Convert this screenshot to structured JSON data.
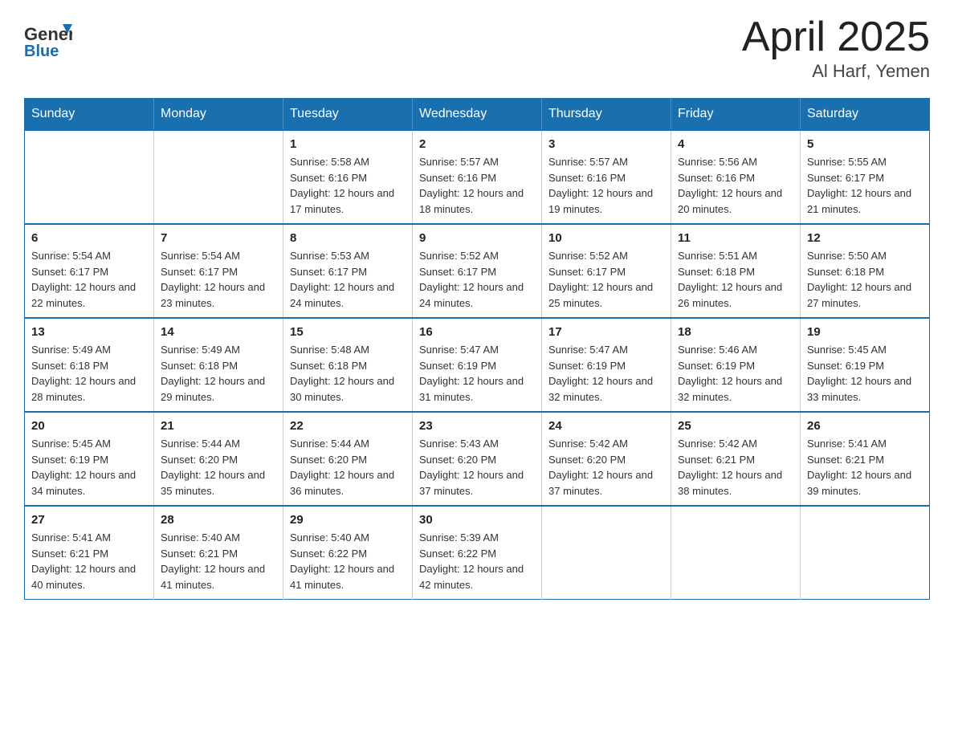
{
  "header": {
    "logo_general": "General",
    "logo_blue": "Blue",
    "title": "April 2025",
    "subtitle": "Al Harf, Yemen"
  },
  "days_of_week": [
    "Sunday",
    "Monday",
    "Tuesday",
    "Wednesday",
    "Thursday",
    "Friday",
    "Saturday"
  ],
  "weeks": [
    {
      "days": [
        {
          "number": "",
          "sunrise": "",
          "sunset": "",
          "daylight": ""
        },
        {
          "number": "",
          "sunrise": "",
          "sunset": "",
          "daylight": ""
        },
        {
          "number": "1",
          "sunrise": "Sunrise: 5:58 AM",
          "sunset": "Sunset: 6:16 PM",
          "daylight": "Daylight: 12 hours and 17 minutes."
        },
        {
          "number": "2",
          "sunrise": "Sunrise: 5:57 AM",
          "sunset": "Sunset: 6:16 PM",
          "daylight": "Daylight: 12 hours and 18 minutes."
        },
        {
          "number": "3",
          "sunrise": "Sunrise: 5:57 AM",
          "sunset": "Sunset: 6:16 PM",
          "daylight": "Daylight: 12 hours and 19 minutes."
        },
        {
          "number": "4",
          "sunrise": "Sunrise: 5:56 AM",
          "sunset": "Sunset: 6:16 PM",
          "daylight": "Daylight: 12 hours and 20 minutes."
        },
        {
          "number": "5",
          "sunrise": "Sunrise: 5:55 AM",
          "sunset": "Sunset: 6:17 PM",
          "daylight": "Daylight: 12 hours and 21 minutes."
        }
      ]
    },
    {
      "days": [
        {
          "number": "6",
          "sunrise": "Sunrise: 5:54 AM",
          "sunset": "Sunset: 6:17 PM",
          "daylight": "Daylight: 12 hours and 22 minutes."
        },
        {
          "number": "7",
          "sunrise": "Sunrise: 5:54 AM",
          "sunset": "Sunset: 6:17 PM",
          "daylight": "Daylight: 12 hours and 23 minutes."
        },
        {
          "number": "8",
          "sunrise": "Sunrise: 5:53 AM",
          "sunset": "Sunset: 6:17 PM",
          "daylight": "Daylight: 12 hours and 24 minutes."
        },
        {
          "number": "9",
          "sunrise": "Sunrise: 5:52 AM",
          "sunset": "Sunset: 6:17 PM",
          "daylight": "Daylight: 12 hours and 24 minutes."
        },
        {
          "number": "10",
          "sunrise": "Sunrise: 5:52 AM",
          "sunset": "Sunset: 6:17 PM",
          "daylight": "Daylight: 12 hours and 25 minutes."
        },
        {
          "number": "11",
          "sunrise": "Sunrise: 5:51 AM",
          "sunset": "Sunset: 6:18 PM",
          "daylight": "Daylight: 12 hours and 26 minutes."
        },
        {
          "number": "12",
          "sunrise": "Sunrise: 5:50 AM",
          "sunset": "Sunset: 6:18 PM",
          "daylight": "Daylight: 12 hours and 27 minutes."
        }
      ]
    },
    {
      "days": [
        {
          "number": "13",
          "sunrise": "Sunrise: 5:49 AM",
          "sunset": "Sunset: 6:18 PM",
          "daylight": "Daylight: 12 hours and 28 minutes."
        },
        {
          "number": "14",
          "sunrise": "Sunrise: 5:49 AM",
          "sunset": "Sunset: 6:18 PM",
          "daylight": "Daylight: 12 hours and 29 minutes."
        },
        {
          "number": "15",
          "sunrise": "Sunrise: 5:48 AM",
          "sunset": "Sunset: 6:18 PM",
          "daylight": "Daylight: 12 hours and 30 minutes."
        },
        {
          "number": "16",
          "sunrise": "Sunrise: 5:47 AM",
          "sunset": "Sunset: 6:19 PM",
          "daylight": "Daylight: 12 hours and 31 minutes."
        },
        {
          "number": "17",
          "sunrise": "Sunrise: 5:47 AM",
          "sunset": "Sunset: 6:19 PM",
          "daylight": "Daylight: 12 hours and 32 minutes."
        },
        {
          "number": "18",
          "sunrise": "Sunrise: 5:46 AM",
          "sunset": "Sunset: 6:19 PM",
          "daylight": "Daylight: 12 hours and 32 minutes."
        },
        {
          "number": "19",
          "sunrise": "Sunrise: 5:45 AM",
          "sunset": "Sunset: 6:19 PM",
          "daylight": "Daylight: 12 hours and 33 minutes."
        }
      ]
    },
    {
      "days": [
        {
          "number": "20",
          "sunrise": "Sunrise: 5:45 AM",
          "sunset": "Sunset: 6:19 PM",
          "daylight": "Daylight: 12 hours and 34 minutes."
        },
        {
          "number": "21",
          "sunrise": "Sunrise: 5:44 AM",
          "sunset": "Sunset: 6:20 PM",
          "daylight": "Daylight: 12 hours and 35 minutes."
        },
        {
          "number": "22",
          "sunrise": "Sunrise: 5:44 AM",
          "sunset": "Sunset: 6:20 PM",
          "daylight": "Daylight: 12 hours and 36 minutes."
        },
        {
          "number": "23",
          "sunrise": "Sunrise: 5:43 AM",
          "sunset": "Sunset: 6:20 PM",
          "daylight": "Daylight: 12 hours and 37 minutes."
        },
        {
          "number": "24",
          "sunrise": "Sunrise: 5:42 AM",
          "sunset": "Sunset: 6:20 PM",
          "daylight": "Daylight: 12 hours and 37 minutes."
        },
        {
          "number": "25",
          "sunrise": "Sunrise: 5:42 AM",
          "sunset": "Sunset: 6:21 PM",
          "daylight": "Daylight: 12 hours and 38 minutes."
        },
        {
          "number": "26",
          "sunrise": "Sunrise: 5:41 AM",
          "sunset": "Sunset: 6:21 PM",
          "daylight": "Daylight: 12 hours and 39 minutes."
        }
      ]
    },
    {
      "days": [
        {
          "number": "27",
          "sunrise": "Sunrise: 5:41 AM",
          "sunset": "Sunset: 6:21 PM",
          "daylight": "Daylight: 12 hours and 40 minutes."
        },
        {
          "number": "28",
          "sunrise": "Sunrise: 5:40 AM",
          "sunset": "Sunset: 6:21 PM",
          "daylight": "Daylight: 12 hours and 41 minutes."
        },
        {
          "number": "29",
          "sunrise": "Sunrise: 5:40 AM",
          "sunset": "Sunset: 6:22 PM",
          "daylight": "Daylight: 12 hours and 41 minutes."
        },
        {
          "number": "30",
          "sunrise": "Sunrise: 5:39 AM",
          "sunset": "Sunset: 6:22 PM",
          "daylight": "Daylight: 12 hours and 42 minutes."
        },
        {
          "number": "",
          "sunrise": "",
          "sunset": "",
          "daylight": ""
        },
        {
          "number": "",
          "sunrise": "",
          "sunset": "",
          "daylight": ""
        },
        {
          "number": "",
          "sunrise": "",
          "sunset": "",
          "daylight": ""
        }
      ]
    }
  ]
}
